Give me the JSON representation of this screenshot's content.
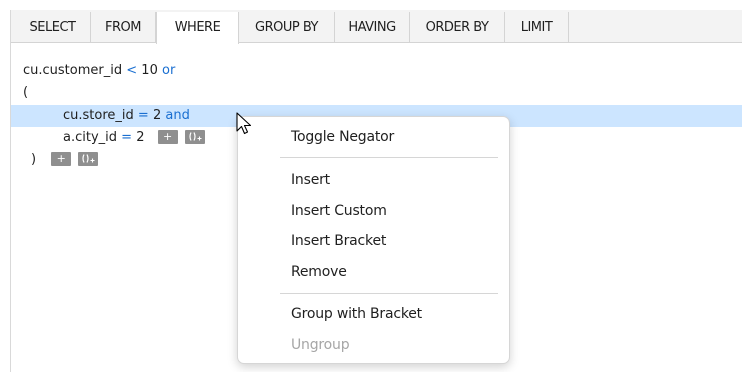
{
  "tabs": [
    "SELECT",
    "FROM",
    "WHERE",
    "GROUP BY",
    "HAVING",
    "ORDER BY",
    "LIMIT"
  ],
  "active_tab": "WHERE",
  "editor": {
    "line1": {
      "text": "cu.customer_id",
      "op": "<",
      "value": "10",
      "keyword": "or"
    },
    "line2": {
      "text": "("
    },
    "line3": {
      "text": "cu.store_id",
      "op": "=",
      "value": "2",
      "keyword": "and"
    },
    "line4": {
      "text": "a.city_id",
      "op": "=",
      "value": "2"
    },
    "line5": {
      "text": ")"
    },
    "add_button": "+"
  },
  "context_menu": {
    "items": [
      "Toggle Negator",
      "Insert",
      "Insert Custom",
      "Insert Bracket",
      "Remove",
      "Group with Bracket",
      "Ungroup"
    ],
    "disabled": [
      "Ungroup"
    ]
  },
  "colors": {
    "accent": "#1a6fd1",
    "highlight": "#cce5ff",
    "tab_bar": "#f3f3f3",
    "mini_button": "#8f8f8f"
  },
  "icons": {
    "add": "plus-icon",
    "insert_function": "function-plus-icon",
    "cursor": "mouse-pointer-icon"
  }
}
